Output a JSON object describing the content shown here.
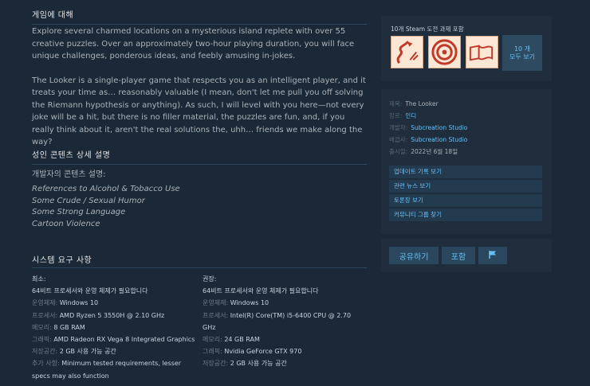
{
  "about": {
    "title": "게임에 대해",
    "para1": "Explore several charmed locations on a mysterious island replete with over 55 creative puzzles. Over an approximately two-hour playing duration, you will face unique challenges, ponderous ideas, and feebly amusing in-jokes.",
    "para2": "The Looker is a single-player game that respects you as an intelligent player, and it treats your time as… reasonably valuable (I mean, don't let me pull you off solving the Riemann hypothesis or anything). As such, I will level with you here—not every joke will be a hit, but there is no filler material, the puzzles are fun, and, if you really think about it, aren't the real solutions the, uhh… friends we make along the way?"
  },
  "mature": {
    "title": "성인 콘텐츠 상세 설명",
    "intro": "개발자의 콘텐츠 설명:",
    "items": [
      "References to Alcohol & Tobacco Use",
      "Some Crude / Sexual Humor",
      "Some Strong Language",
      "Cartoon Violence"
    ]
  },
  "sysreq": {
    "title": "시스템 요구 사항",
    "minimum": {
      "heading": "최소:",
      "note": "64비트 프로세서와 운영 체제가 필요합니다",
      "rows": [
        {
          "key": "운영체제:",
          "val": "Windows 10"
        },
        {
          "key": "프로세서:",
          "val": "AMD Ryzen 5 3550H @ 2.10 GHz"
        },
        {
          "key": "메모리:",
          "val": "8 GB RAM"
        },
        {
          "key": "그래픽:",
          "val": "AMD Radeon RX Vega 8 Integrated Graphics"
        },
        {
          "key": "저장공간:",
          "val": "2 GB 사용 가능 공간"
        },
        {
          "key": "추가 사항:",
          "val": "Minimum tested requirements, lesser specs may also function"
        }
      ]
    },
    "recommended": {
      "heading": "권장:",
      "note": "64비트 프로세서와 운영 체제가 필요합니다",
      "rows": [
        {
          "key": "운영체제:",
          "val": "Windows 10"
        },
        {
          "key": "프로세서:",
          "val": "Intel(R) Core(TM) i5-6400 CPU @ 2.70 GHz"
        },
        {
          "key": "메모리:",
          "val": "24 GB RAM"
        },
        {
          "key": "그래픽:",
          "val": "Nvidia GeForce GTX 970"
        },
        {
          "key": "저장공간:",
          "val": "2 GB 사용 가능 공간"
        }
      ]
    }
  },
  "achievements": {
    "title": "10개 Steam 도전 과제 포함",
    "more_line1": "10 개",
    "more_line2": "모두 보기",
    "icons": [
      "snake-icon",
      "target-icon",
      "map-icon"
    ]
  },
  "info": {
    "title_key": "제목:",
    "title_val": "The Looker",
    "genre_key": "장르:",
    "genre_val": "인디",
    "dev_key": "개발자:",
    "dev_val": "Subcreation Studio",
    "pub_key": "배급사:",
    "pub_val": "Subcreation Studio",
    "date_key": "출시일:",
    "date_val": "2022년 6월 18일",
    "buttons": [
      "업데이트 기록 보기",
      "관련 뉴스 보기",
      "토론장 보기",
      "커뮤니티 그룹 찾기"
    ]
  },
  "share": {
    "share_label": "공유하기",
    "embed_label": "포함",
    "flag_icon": "flag-icon"
  },
  "colors": {
    "background": "#1b2838",
    "link": "#66c0f4",
    "panel": "#1f2d3d"
  }
}
